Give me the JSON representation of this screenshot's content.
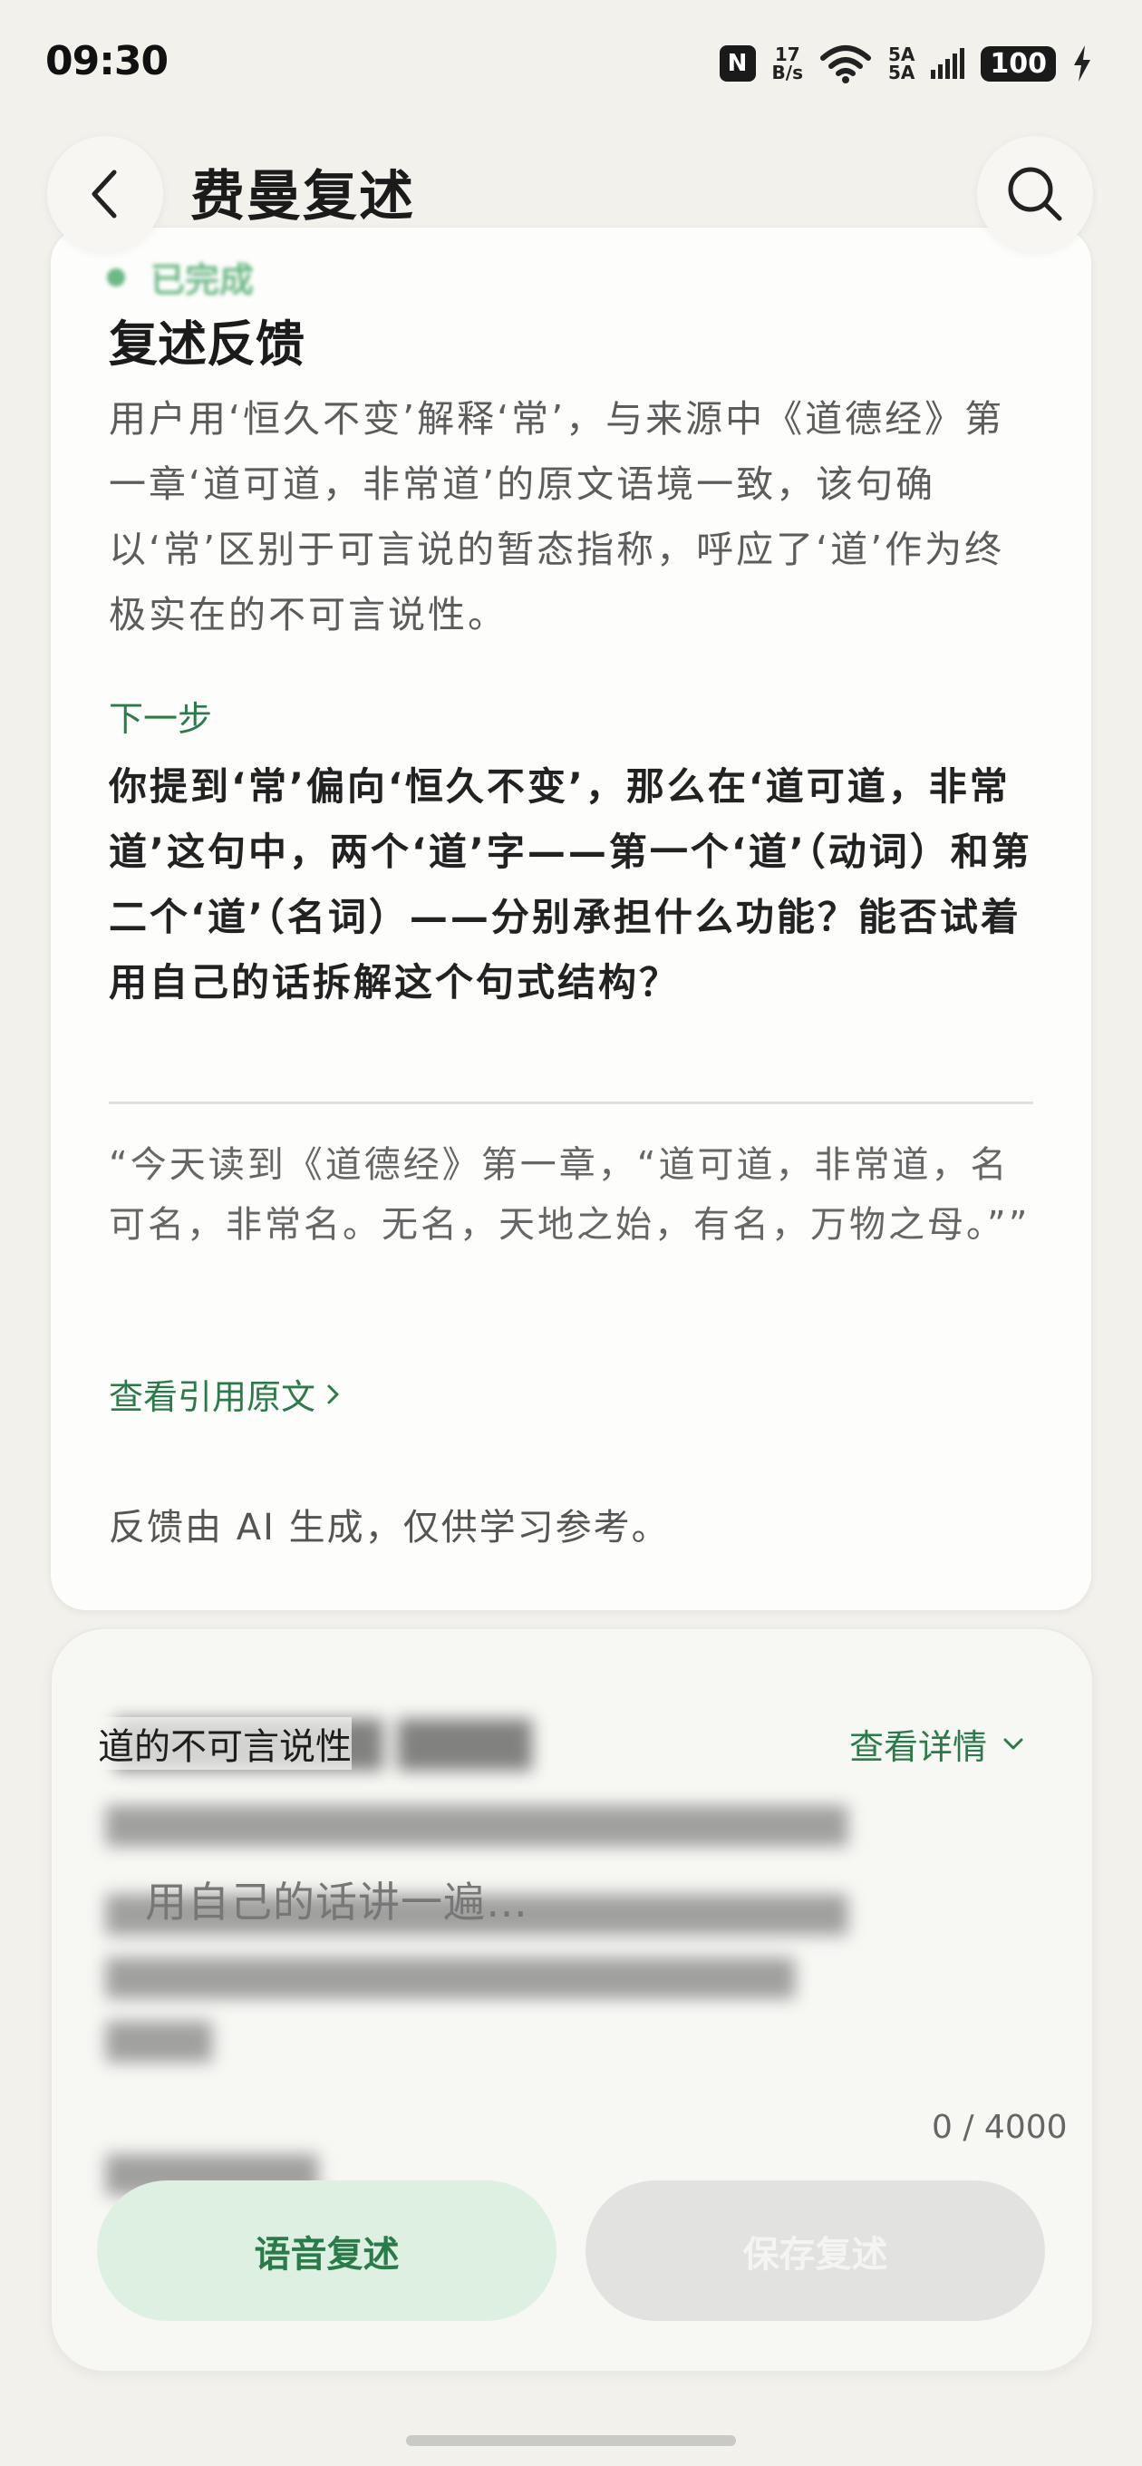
{
  "status_bar": {
    "time": "09:30",
    "nfc": "N",
    "speed_top": "17",
    "speed_bottom": "B/s",
    "sim_top": "5A",
    "sim_bottom": "5A",
    "battery": "100"
  },
  "header": {
    "title": "费曼复述"
  },
  "feedback": {
    "status": "已完成",
    "title": "复述反馈",
    "body": "用户用‘恒久不变’解释‘常’，与来源中《道德经》第一章‘道可道，非常道’的原文语境一致，该句确以‘常’区别于可言说的暂态指称，呼应了‘道’作为终极实在的不可言说性。",
    "next_label": "下一步",
    "next_body": "你提到‘常’偏向‘恒久不变’，那么在‘道可道，非常道’这句中，两个‘道’字——第一个‘道’（动词）和第二个‘道’（名词）——分别承担什么功能？能否试着用自己的话拆解这个句式结构？",
    "quote": "“今天读到《道德经》第一章，“道可道，非常道，名可名，非常名。无名，天地之始，有名，万物之母。””",
    "view_citation": "查看引用原文",
    "disclaimer": "反馈由 AI 生成，仅供学习参考。"
  },
  "compose": {
    "topic": "道的不可言说性",
    "view_details": "查看详情",
    "placeholder": "用自己的话讲一遍…",
    "counter": "0 / 4000",
    "voice_button": "语音复述",
    "save_button": "保存复述"
  },
  "colors": {
    "accent_green": "#2a7a4a",
    "done_green": "#4aa86b",
    "voice_button_bg": "#ddf0e2",
    "disabled_button_bg": "#e2e3e0",
    "page_bg": "#f3f1ec"
  }
}
